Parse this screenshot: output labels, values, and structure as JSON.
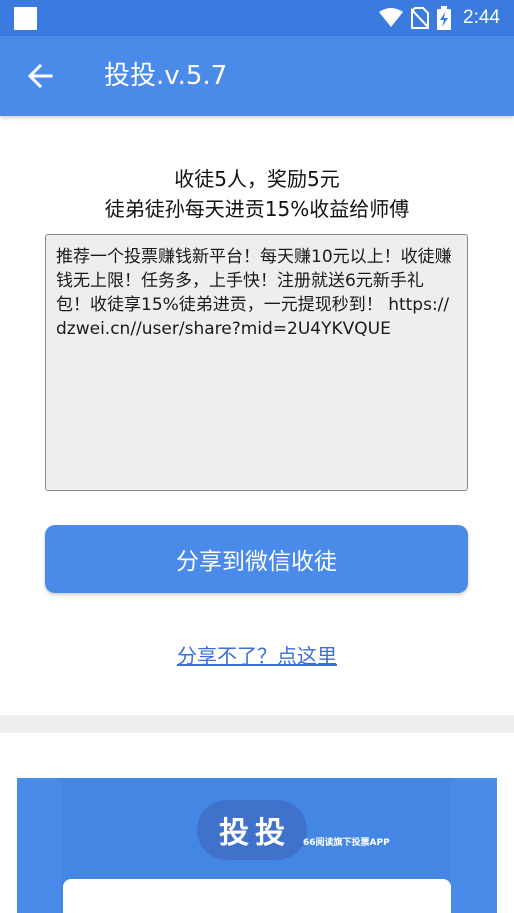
{
  "status_bar": {
    "time": "2:44",
    "icons": [
      "wifi-icon",
      "no-sim-icon",
      "battery-charging-icon"
    ]
  },
  "app_bar": {
    "title": "投投.v.5.7",
    "back_icon": "arrow-left-icon"
  },
  "invite": {
    "line1": "收徒5人，奖励5元",
    "line2": "徒弟徒孙每天进贡15%收益给师傅",
    "share_text": "推荐一个投票赚钱新平台！每天赚10元以上！收徒赚钱无上限！任务多，上手快！注册就送6元新手礼包！收徒享15%徒弟进贡，一元提现秒到！ https://dzwei.cn//user/share?mid=2U4YKVQUE",
    "share_button_label": "分享到微信收徒",
    "help_link_label": "分享不了？点这里"
  },
  "banner": {
    "logo_text": "投投",
    "subtitle": "66阅读旗下投票APP"
  },
  "colors": {
    "primary": "#4a8ae8",
    "status_bar": "#3b7be0",
    "link": "#3b6fd6"
  }
}
